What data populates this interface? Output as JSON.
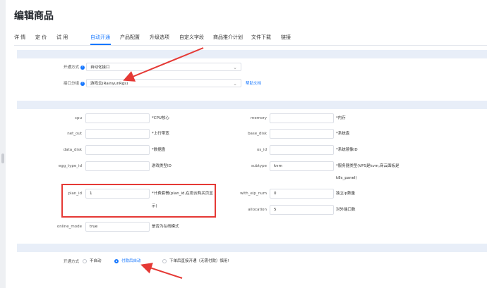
{
  "page": {
    "title": "编辑商品"
  },
  "tabs": [
    "详 情",
    "定 价",
    "试 用",
    "自动开通",
    "产品配置",
    "升级选项",
    "自定义字段",
    "商品推介计划",
    "文件下载",
    "链接"
  ],
  "section1": {
    "open_mode_label": "开通方式",
    "open_mode_value": "自动化接口",
    "interface_group_label": "接口分组",
    "interface_group_value": "游戏云(RainyunRgs)",
    "help_link": "帮助文档"
  },
  "fields": {
    "cpu": {
      "label": "cpu",
      "value": "",
      "hint": "*CPU核心"
    },
    "memory": {
      "label": "memory",
      "value": "",
      "hint": "*内存"
    },
    "net_out": {
      "label": "net_out",
      "value": "",
      "hint": "*上行带宽"
    },
    "base_disk": {
      "label": "base_disk",
      "value": "",
      "hint": "*系统盘"
    },
    "data_disk": {
      "label": "data_disk",
      "value": "",
      "hint": "*数据盘"
    },
    "os_id": {
      "label": "os_id",
      "value": "",
      "hint": "*系统镜像ID"
    },
    "egg_type_id": {
      "label": "egg_type_id",
      "value": "",
      "hint": "游戏类型ID"
    },
    "subtype": {
      "label": "subtype",
      "value": "kvm",
      "hint_line1": "*服务器类型(VPS是kvm,商云面板是",
      "hint_line2": "k8s_panel)"
    },
    "plan_id": {
      "label": "plan_id",
      "value": "1",
      "hint_line1": "*计费套餐(plan_id,在雨云购买页显",
      "hint_line2": "示)"
    },
    "with_eip_num": {
      "label": "with_eip_num",
      "value": "0",
      "hint": "独立ip数量"
    },
    "allocation": {
      "label": "allocation",
      "value": "5",
      "hint": "对外端口数"
    },
    "online_mode": {
      "label": "online_mode",
      "value": "true",
      "hint": "是否为在线模式"
    }
  },
  "section3": {
    "label": "开通方式",
    "options": [
      "不自动",
      "付款后自动",
      "下单后直接开通（无需付款）慎用!"
    ],
    "selected": "付款后自动"
  },
  "colors": {
    "accent": "#1677ff",
    "highlight": "#e53935",
    "band": "#e8eef8"
  }
}
